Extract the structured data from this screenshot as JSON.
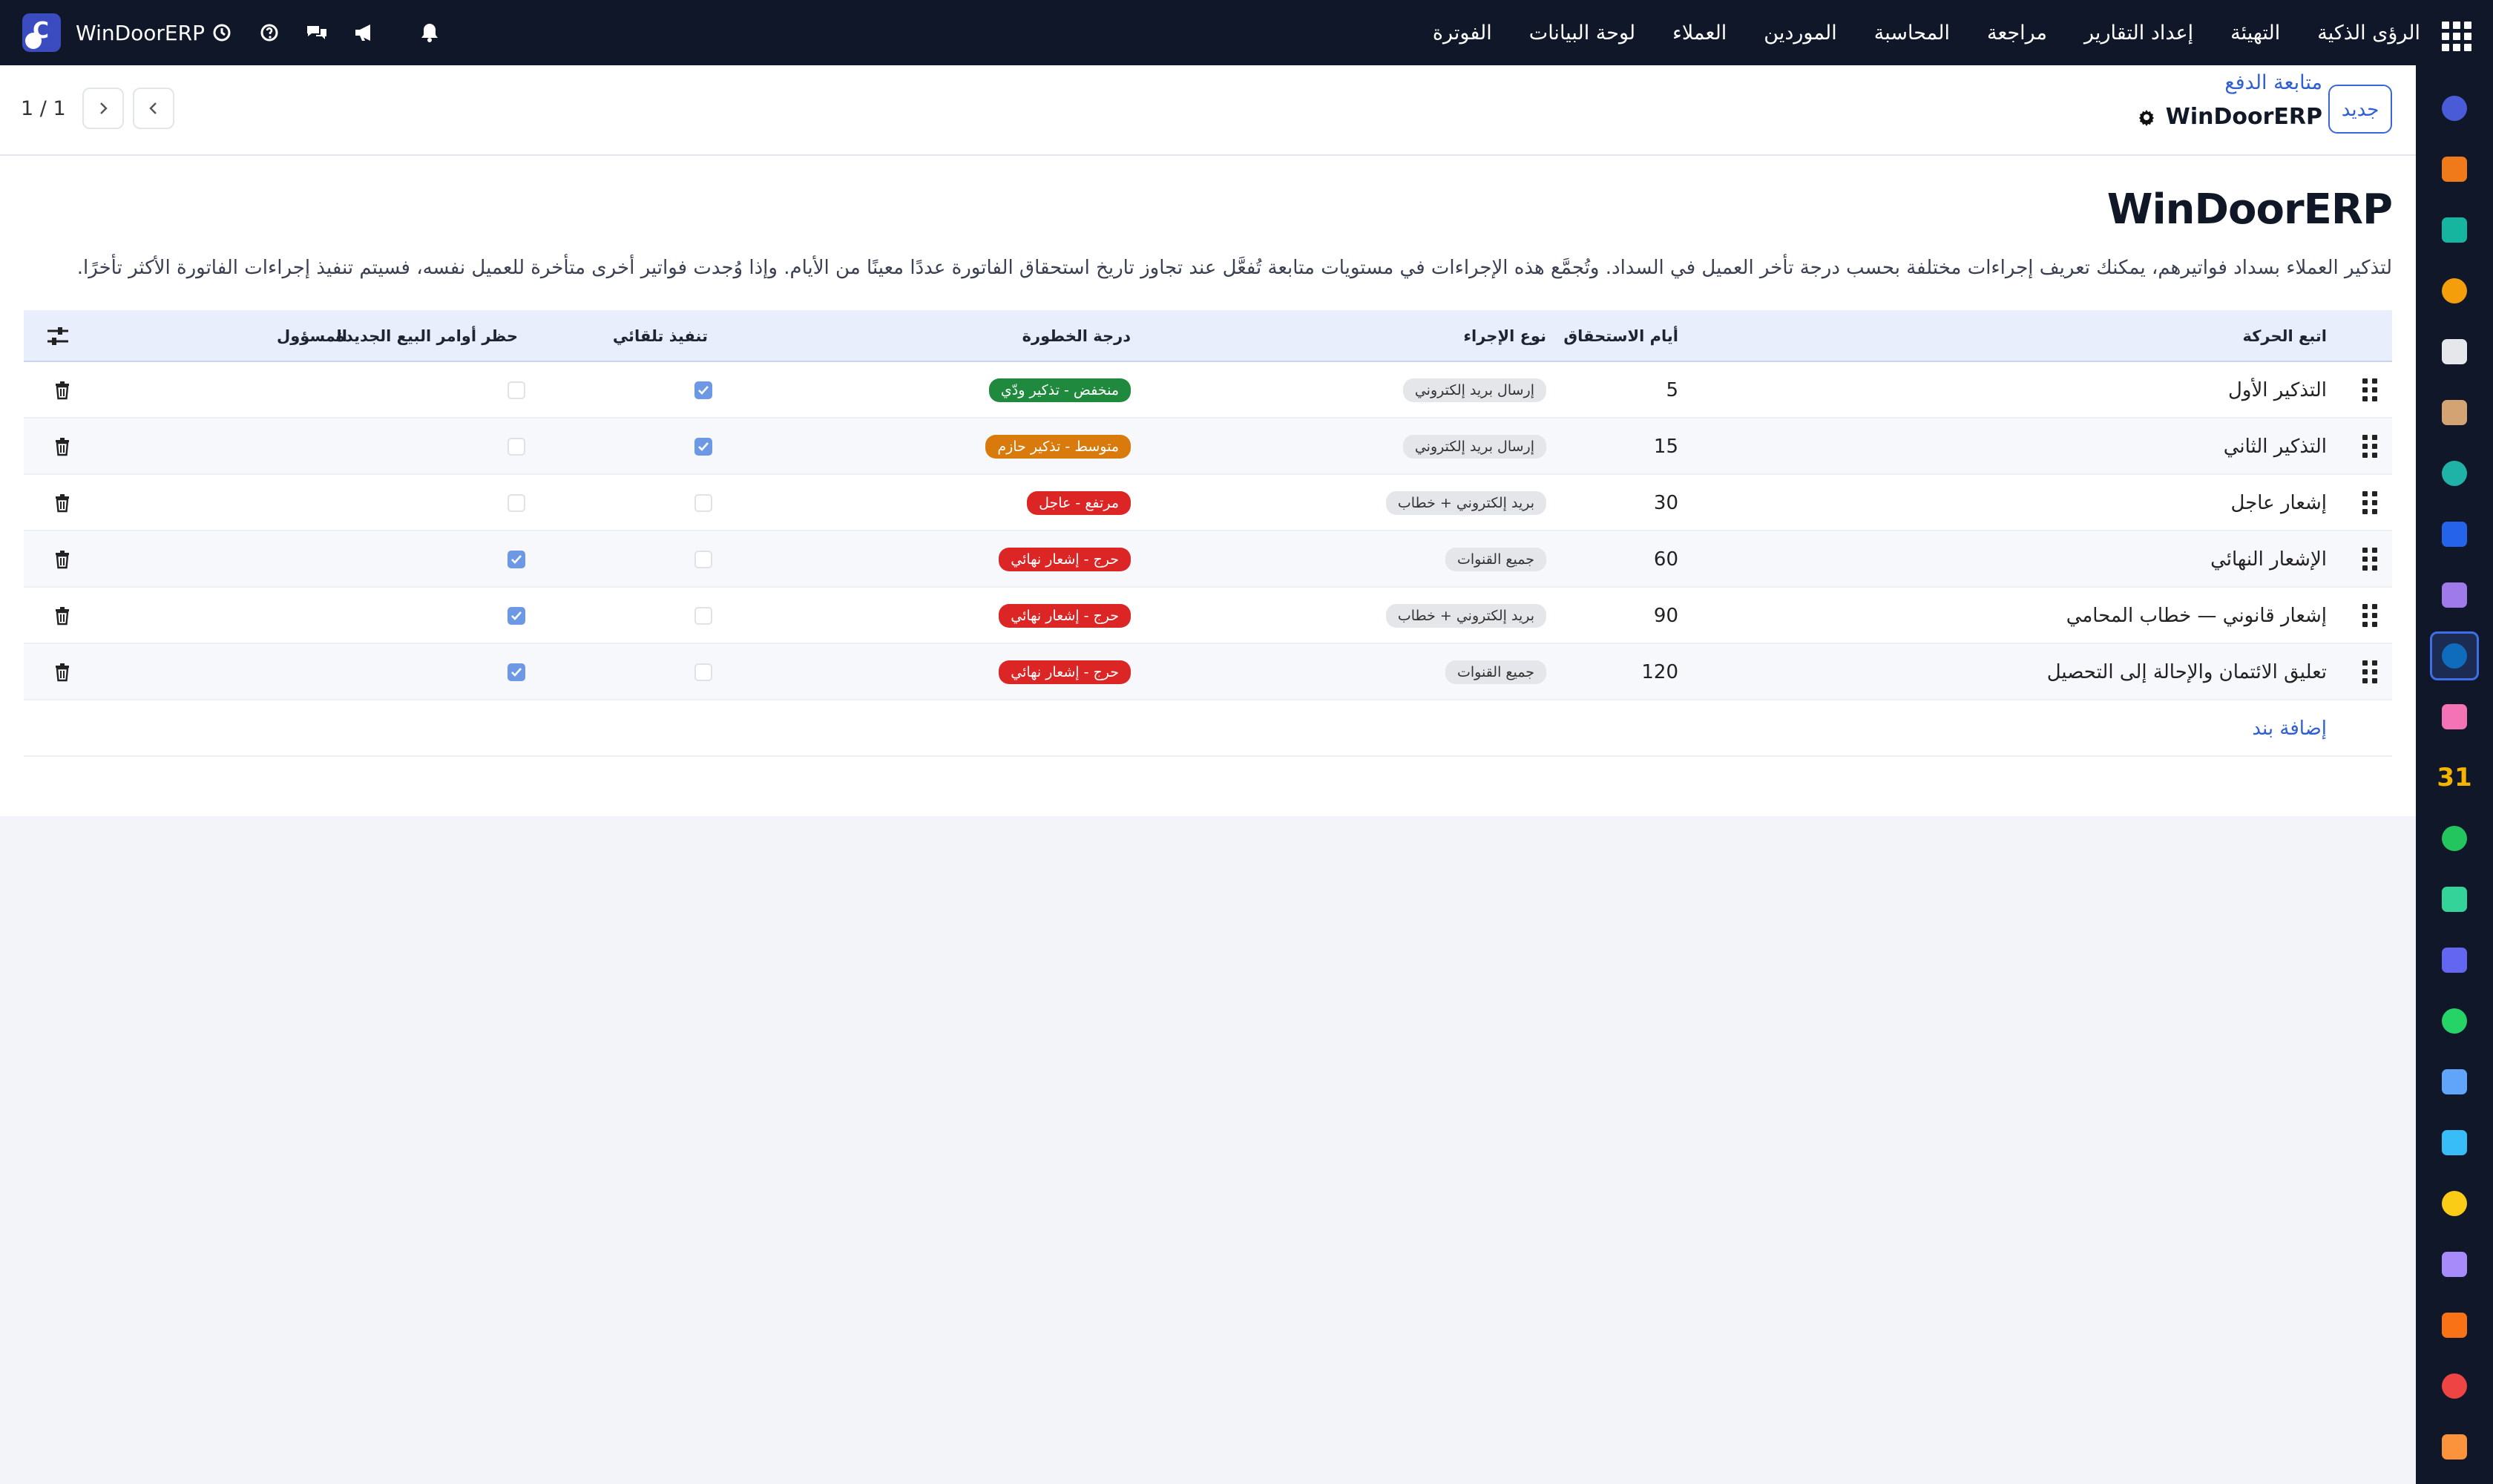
{
  "topbar": {
    "app_name": "WinDoorERP",
    "menu": [
      "الفوترة",
      "لوحة البيانات",
      "العملاء",
      "الموردين",
      "المحاسبة",
      "مراجعة",
      "إعداد التقارير",
      "التهيئة",
      "الرؤى الذكية"
    ],
    "system_icons": [
      "clock-icon",
      "help-icon",
      "chat-icon",
      "megaphone-icon",
      "bell-icon"
    ]
  },
  "controls": {
    "new_label": "جديد",
    "breadcrumb": "متابعة الدفع",
    "record_title": "WinDoorERP",
    "pager": "1 / 1"
  },
  "page": {
    "heading": "WinDoorERP",
    "description": "لتذكير العملاء بسداد فواتيرهم، يمكنك تعريف إجراءات مختلفة بحسب درجة تأخر العميل في السداد. وتُجمَّع هذه الإجراءات في مستويات متابعة تُفعَّل عند تجاوز تاريخ استحقاق الفاتورة عددًا معينًا من الأيام. وإذا وُجدت فواتير أخرى متأخرة للعميل نفسه، فسيتم تنفيذ إجراءات الفاتورة الأكثر تأخرًا."
  },
  "table": {
    "columns": {
      "action": "اتبع الحركة",
      "days": "أيام الاستحقاق",
      "type": "نوع الإجراء",
      "severity": "درجة الخطورة",
      "auto": "تنفيذ تلقائي",
      "block": "حظر أوامر البيع الجديدة",
      "owner": "المسؤول"
    },
    "rows": [
      {
        "action": "التذكير الأول",
        "days": "5",
        "type": "إرسال بريد إلكتروني",
        "severity": "منخفض - تذكير ودّي",
        "severity_color": "#1f8a3d",
        "auto": true,
        "block": false
      },
      {
        "action": "التذكير الثاني",
        "days": "15",
        "type": "إرسال بريد إلكتروني",
        "severity": "متوسط - تذكير حازم",
        "severity_color": "#d97a0c",
        "auto": true,
        "block": false
      },
      {
        "action": "إشعار عاجل",
        "days": "30",
        "type": "بريد إلكتروني + خطاب",
        "severity": "مرتفع - عاجل",
        "severity_color": "#dc2626",
        "auto": false,
        "block": false
      },
      {
        "action": "الإشعار النهائي",
        "days": "60",
        "type": "جميع القنوات",
        "severity": "حرج - إشعار نهائي",
        "severity_color": "#dc2626",
        "auto": false,
        "block": true
      },
      {
        "action": "إشعار قانوني — خطاب المحامي",
        "days": "90",
        "type": "بريد إلكتروني + خطاب",
        "severity": "حرج - إشعار نهائي",
        "severity_color": "#dc2626",
        "auto": false,
        "block": true
      },
      {
        "action": "تعليق الائتمان والإحالة إلى التحصيل",
        "days": "120",
        "type": "جميع القنوات",
        "severity": "حرج - إشعار نهائي",
        "severity_color": "#dc2626",
        "auto": false,
        "block": true
      }
    ],
    "add_line": "إضافة بند"
  },
  "rail": {
    "apps": [
      "mail-app-icon",
      "chat-app-icon",
      "sign-app-icon",
      "charts-app-icon",
      "cube-app-icon",
      "photo-app-icon",
      "todo-app-icon",
      "book-app-icon",
      "package-app-icon",
      "sharepoint-app-icon",
      "team-app-icon",
      "calendar-app-icon",
      "pen-app-icon",
      "contacts-app-icon",
      "dashboard-app-icon",
      "whatsapp-app-icon",
      "clock-app-icon",
      "wave-app-icon",
      "send-app-icon",
      "bars-app-icon",
      "box-app-icon",
      "pie-app-icon",
      "hex-app-icon"
    ],
    "calendar_label": "31"
  }
}
